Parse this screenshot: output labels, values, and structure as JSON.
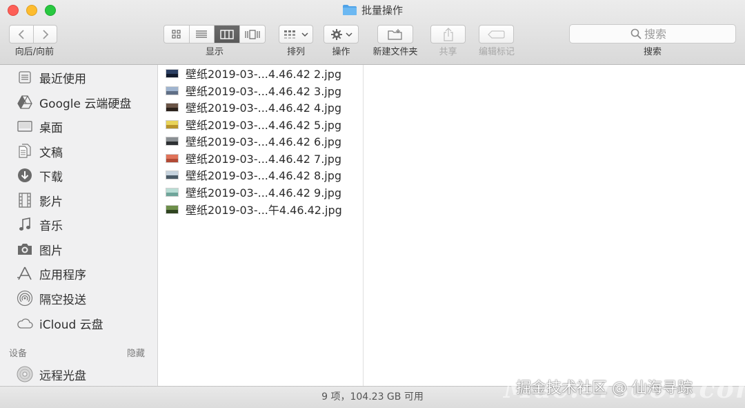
{
  "window": {
    "title": "批量操作"
  },
  "toolbar": {
    "nav_label": "向后/向前",
    "view_label": "显示",
    "arrange_label": "排列",
    "action_label": "操作",
    "new_folder_label": "新建文件夹",
    "share_label": "共享",
    "tags_label": "编辑标记",
    "search_label": "搜索",
    "search_placeholder": "搜索"
  },
  "sidebar": {
    "items": [
      {
        "label": "最近使用",
        "icon": "recents-icon"
      },
      {
        "label": "Google 云端硬盘",
        "icon": "google-drive-icon"
      },
      {
        "label": "桌面",
        "icon": "desktop-icon"
      },
      {
        "label": "文稿",
        "icon": "documents-icon"
      },
      {
        "label": "下载",
        "icon": "downloads-icon"
      },
      {
        "label": "影片",
        "icon": "movies-icon"
      },
      {
        "label": "音乐",
        "icon": "music-icon"
      },
      {
        "label": "图片",
        "icon": "pictures-icon"
      },
      {
        "label": "应用程序",
        "icon": "applications-icon"
      },
      {
        "label": "隔空投送",
        "icon": "airdrop-icon"
      },
      {
        "label": "iCloud 云盘",
        "icon": "icloud-icon"
      }
    ],
    "devices_header": "设备",
    "hide_label": "隐藏",
    "devices": [
      {
        "label": "远程光盘",
        "icon": "remote-disc-icon"
      }
    ]
  },
  "files": [
    {
      "name": "壁纸2019-03-...4.46.42 2.jpg",
      "sky": "#2b3f63",
      "ground": "#111a2c"
    },
    {
      "name": "壁纸2019-03-...4.46.42 3.jpg",
      "sky": "#9fb4cf",
      "ground": "#5f6f86"
    },
    {
      "name": "壁纸2019-03-...4.46.42 4.jpg",
      "sky": "#6a5446",
      "ground": "#2b211b"
    },
    {
      "name": "壁纸2019-03-...4.46.42 5.jpg",
      "sky": "#e8d45a",
      "ground": "#b8932a"
    },
    {
      "name": "壁纸2019-03-...4.46.42 6.jpg",
      "sky": "#8a8f93",
      "ground": "#2d3033"
    },
    {
      "name": "壁纸2019-03-...4.46.42 7.jpg",
      "sky": "#e0735a",
      "ground": "#b24a35"
    },
    {
      "name": "壁纸2019-03-...4.46.42 8.jpg",
      "sky": "#c6d3de",
      "ground": "#4a5a66"
    },
    {
      "name": "壁纸2019-03-...4.46.42 9.jpg",
      "sky": "#b9ddd5",
      "ground": "#6fa59a"
    },
    {
      "name": "壁纸2019-03-...午4.46.42.jpg",
      "sky": "#6e8f4a",
      "ground": "#2f4420"
    }
  ],
  "status": {
    "text": "9 项，104.23 GB 可用"
  },
  "watermark": {
    "ghost": "Mac.orsoon.com",
    "text": "掘金技术社区 @ 仙海寻踪"
  }
}
